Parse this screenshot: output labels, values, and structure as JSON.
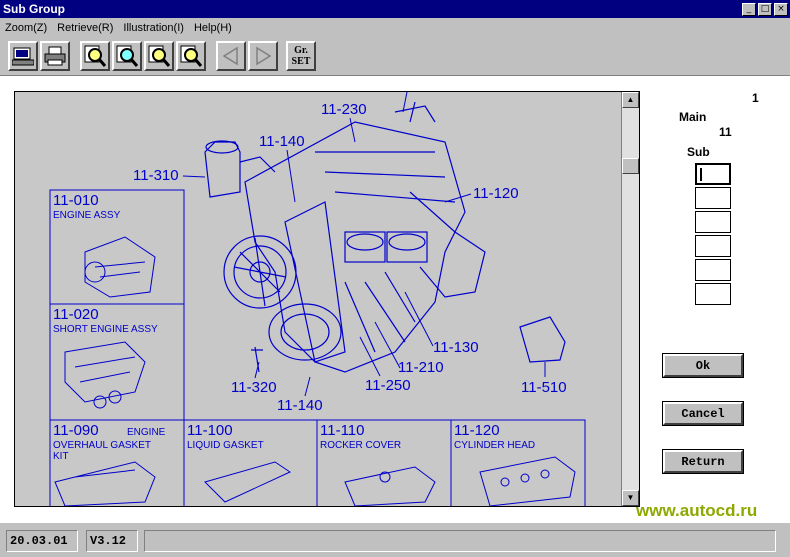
{
  "window": {
    "title": "Sub Group",
    "controls": [
      "_",
      "□",
      "×"
    ]
  },
  "menu": [
    "Zoom(Z)",
    "Retrieve(R)",
    "Illustration(I)",
    "Help(H)"
  ],
  "toolbar": {
    "gr_set_line1": "Gr.",
    "gr_set_line2": "SET"
  },
  "illustration": {
    "callouts": [
      "11-230",
      "11-140",
      "11-310",
      "11-120",
      "11-130",
      "11-210",
      "11-250",
      "11-320",
      "11-140",
      "11-510"
    ],
    "thumbnails": [
      {
        "code": "11-010",
        "name": "ENGINE ASSY"
      },
      {
        "code": "11-020",
        "name": "SHORT ENGINE ASSY"
      },
      {
        "code": "11-090",
        "name": "ENGINE",
        "name2": "OVERHAUL GASKET",
        "name3": "KIT"
      },
      {
        "code": "11-100",
        "name": "LIQUID GASKET"
      },
      {
        "code": "11-110",
        "name": "ROCKER COVER"
      },
      {
        "code": "11-120",
        "name": "CYLINDER HEAD"
      }
    ]
  },
  "side_panel": {
    "page": "1",
    "main_label": "Main",
    "main_value": "11",
    "sub_label": "Sub",
    "sub_fields": [
      "",
      "",
      "",
      "",
      "",
      ""
    ]
  },
  "buttons": {
    "ok": "Ok",
    "cancel": "Cancel",
    "return": "Return"
  },
  "watermark": "www.autocd.ru",
  "status": {
    "date": "20.03.01",
    "version": "V3.12",
    "message": ""
  },
  "colors": {
    "titlebar": "#000080",
    "line_art": "#0000cc",
    "illus_bg": "#c8c8c8",
    "watermark": "#8fa800"
  }
}
